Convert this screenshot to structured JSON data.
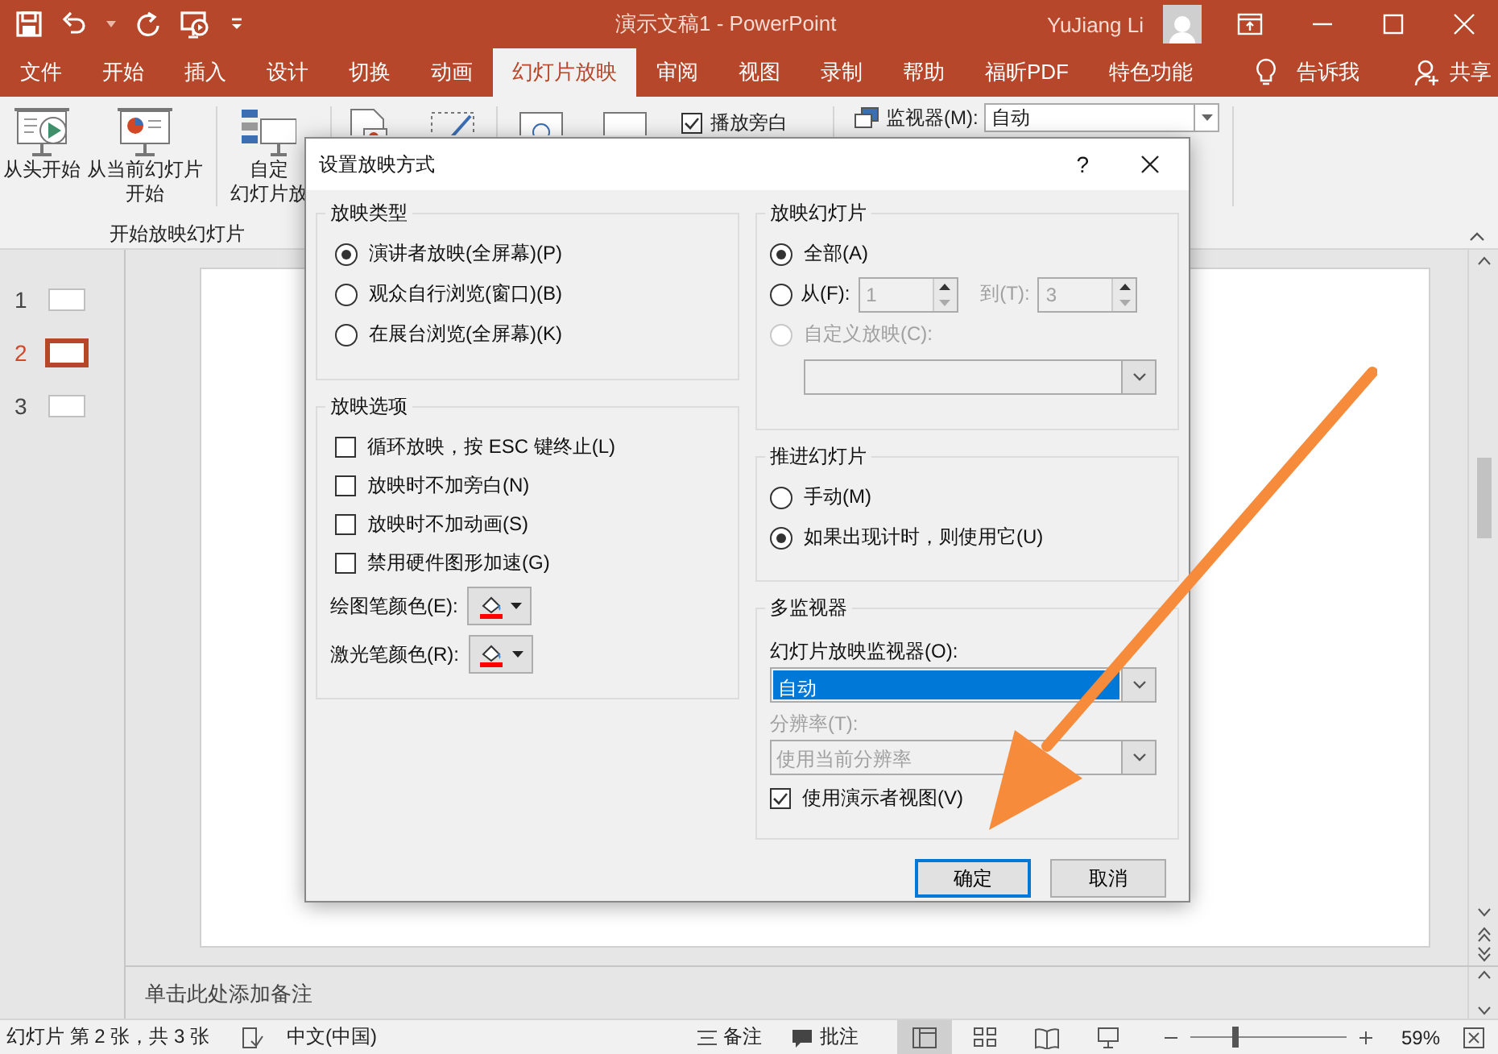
{
  "window": {
    "title": "演示文稿1 - PowerPoint",
    "user": "YuJiang Li"
  },
  "tabs": [
    {
      "label": "文件",
      "selected": false
    },
    {
      "label": "开始",
      "selected": false
    },
    {
      "label": "插入",
      "selected": false
    },
    {
      "label": "设计",
      "selected": false
    },
    {
      "label": "切换",
      "selected": false
    },
    {
      "label": "动画",
      "selected": false
    },
    {
      "label": "幻灯片放映",
      "selected": true
    },
    {
      "label": "审阅",
      "selected": false
    },
    {
      "label": "视图",
      "selected": false
    },
    {
      "label": "录制",
      "selected": false
    },
    {
      "label": "帮助",
      "selected": false
    },
    {
      "label": "福昕PDF",
      "selected": false
    },
    {
      "label": "特色功能",
      "selected": false
    }
  ],
  "tell_me": "告诉我",
  "share": "共享",
  "ribbon": {
    "buttons": [
      {
        "kind": "from_beginning",
        "lines": [
          "从头开始"
        ]
      },
      {
        "kind": "from_current",
        "lines": [
          "从当前幻灯片",
          "开始"
        ]
      },
      {
        "kind": "custom",
        "lines": [
          "自定",
          "幻灯片放"
        ]
      }
    ],
    "group_label": "开始放映幻灯片",
    "narration": {
      "label": "播放旁白",
      "checked": true
    },
    "monitor": {
      "label": "监视器(M):",
      "value": "自动"
    }
  },
  "slides": [
    {
      "number": "1",
      "selected": false
    },
    {
      "number": "2",
      "selected": true
    },
    {
      "number": "3",
      "selected": false
    }
  ],
  "notes_placeholder": "单击此处添加备注",
  "status_bar": {
    "slide_info": "幻灯片 第 2 张，共 3 张",
    "language": "中文(中国)",
    "notes": "备注",
    "comments": "批注",
    "views": [
      {
        "kind": "normal",
        "selected": true
      },
      {
        "kind": "sorter",
        "selected": false
      },
      {
        "kind": "reading",
        "selected": false
      },
      {
        "kind": "slideshow",
        "selected": false
      }
    ],
    "zoom_slider": {
      "level": 0.29
    },
    "zoom": "59%"
  },
  "dialog": {
    "title": "设置放映方式",
    "help": "?",
    "show_type": {
      "title": "放映类型",
      "options": [
        {
          "label": "演讲者放映(全屏幕)(P)",
          "selected": true
        },
        {
          "label": "观众自行浏览(窗口)(B)",
          "selected": false
        },
        {
          "label": "在展台浏览(全屏幕)(K)",
          "selected": false
        }
      ]
    },
    "show_options": {
      "title": "放映选项",
      "checkboxes": [
        {
          "label": "循环放映，按 ESC 键终止(L)",
          "checked": false
        },
        {
          "label": "放映时不加旁白(N)",
          "checked": false
        },
        {
          "label": "放映时不加动画(S)",
          "checked": false
        },
        {
          "label": "禁用硬件图形加速(G)",
          "checked": false
        }
      ],
      "colors": [
        {
          "label": "绘图笔颜色(E):",
          "color": "#ff0000"
        },
        {
          "label": "激光笔颜色(R):",
          "color": "#ff0000"
        }
      ]
    },
    "show_slides": {
      "title": "放映幻灯片",
      "options": [
        {
          "kind": "all",
          "label": "全部(A)",
          "selected": true,
          "disabled": false
        },
        {
          "kind": "range",
          "label": "从(F):",
          "selected": false,
          "disabled": false,
          "from": "1",
          "to_label": "到(T):",
          "to": "3"
        },
        {
          "kind": "custom",
          "label": "自定义放映(C):",
          "selected": false,
          "disabled": true
        }
      ]
    },
    "advance": {
      "title": "推进幻灯片",
      "options": [
        {
          "label": "手动(M)",
          "selected": false
        },
        {
          "label": "如果出现计时，则使用它(U)",
          "selected": true
        }
      ]
    },
    "multi_monitor": {
      "title": "多监视器",
      "monitor_label": "幻灯片放映监视器(O):",
      "monitor": {
        "value": "自动",
        "focused": true
      },
      "resolution_label": "分辨率(T):",
      "resolution": {
        "value": "使用当前分辨率",
        "disabled": true
      },
      "presenter_view": {
        "label": "使用演示者视图(V)",
        "checked": true
      }
    },
    "buttons": [
      {
        "label": "确定",
        "default": true
      },
      {
        "label": "取消",
        "default": false
      }
    ]
  }
}
